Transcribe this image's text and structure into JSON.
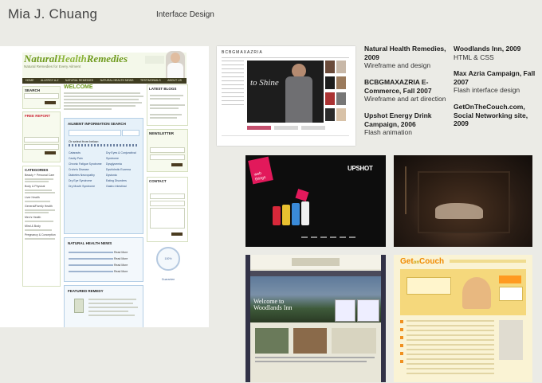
{
  "header": {
    "name": "Mia J. Chuang",
    "section": "Interface Design"
  },
  "natural_health": {
    "logo_part1": "Natural",
    "logo_part2": "Health",
    "logo_part3": "Remedies",
    "tagline": "Natural Remedies for Every Ailment",
    "nav": [
      "HOME",
      "ALLERGY A-Z",
      "NATURAL REMEDIES",
      "NATURAL HEALTH NEWS",
      "TESTIMONIALS",
      "ABOUT US"
    ],
    "search_title": "SEARCH",
    "search_btn": "SUBMIT",
    "free_report_title": "FREE REPORT",
    "categories_title": "CATEGORIES",
    "categories": [
      "Beauty + Personal Care",
      "Body & Physical",
      "Liver Health",
      "General/Family Health",
      "Men's Health",
      "Mind & Body",
      "Pregnancy & Conception"
    ],
    "welcome": "WELCOME",
    "ailment_title": "AILMENT INFORMATION SEARCH",
    "ailment_select": "Or select from below:",
    "ailments_left": [
      "Cataracts",
      "Cavity Pain",
      "Chronic Fatigue Syndrome",
      "Crohn's Disease",
      "Diabetes Neuropathy",
      "Dry Eye Syndrome",
      "Dry Mouth Syndrome"
    ],
    "ailments_right": [
      "Dry Eyes & Conjunctival Syndrome",
      "Dysglycemia",
      "Dyshidrotic Eczema",
      "Dystonia",
      "Eating Disorders",
      "Gastro Intestinal"
    ],
    "news_title": "NATURAL HEALTH NEWS",
    "read_more": "Read More",
    "featured1": "FEATURED REMEDY",
    "featured2": "FEATURED REMEDY",
    "latest_blogs": "LATEST BLOGS",
    "newsletter": "NEWSLETTER",
    "contact": "CONTACT",
    "seal": "100% Guarantee"
  },
  "bcbg": {
    "brand": "BCBGMAXAZRIA",
    "headline": "to Shine"
  },
  "upshot": {
    "logo": "UPSHOT",
    "tag": "web things"
  },
  "woods": {
    "headline": "Welcome to Woodlands Inn"
  },
  "getcouch": {
    "logo_a": "Get",
    "logo_b": "on",
    "logo_c": "Couch"
  },
  "projects": [
    {
      "title": "Natural Health Remedies, 2009",
      "desc": "Wireframe and design"
    },
    {
      "title": "BCBGMAXAZRIA E-Commerce, Fall 2007",
      "desc": "Wireframe and art direction"
    },
    {
      "title": "Upshot Energy Drink Campaign, 2006",
      "desc": "Flash animation"
    },
    {
      "title": "Woodlands Inn, 2009",
      "desc": "HTML & CSS"
    },
    {
      "title": "Max Azria Campaign, Fall 2007",
      "desc": "Flash interface design"
    },
    {
      "title": "GetOnTheCouch.com, Social Networking site, 2009",
      "desc": ""
    }
  ],
  "colors": {
    "background": "#ebebe6",
    "nh_green": "#6e9a1c",
    "nh_nav": "#3e3c20",
    "nh_blue": "#e6f1f9"
  }
}
